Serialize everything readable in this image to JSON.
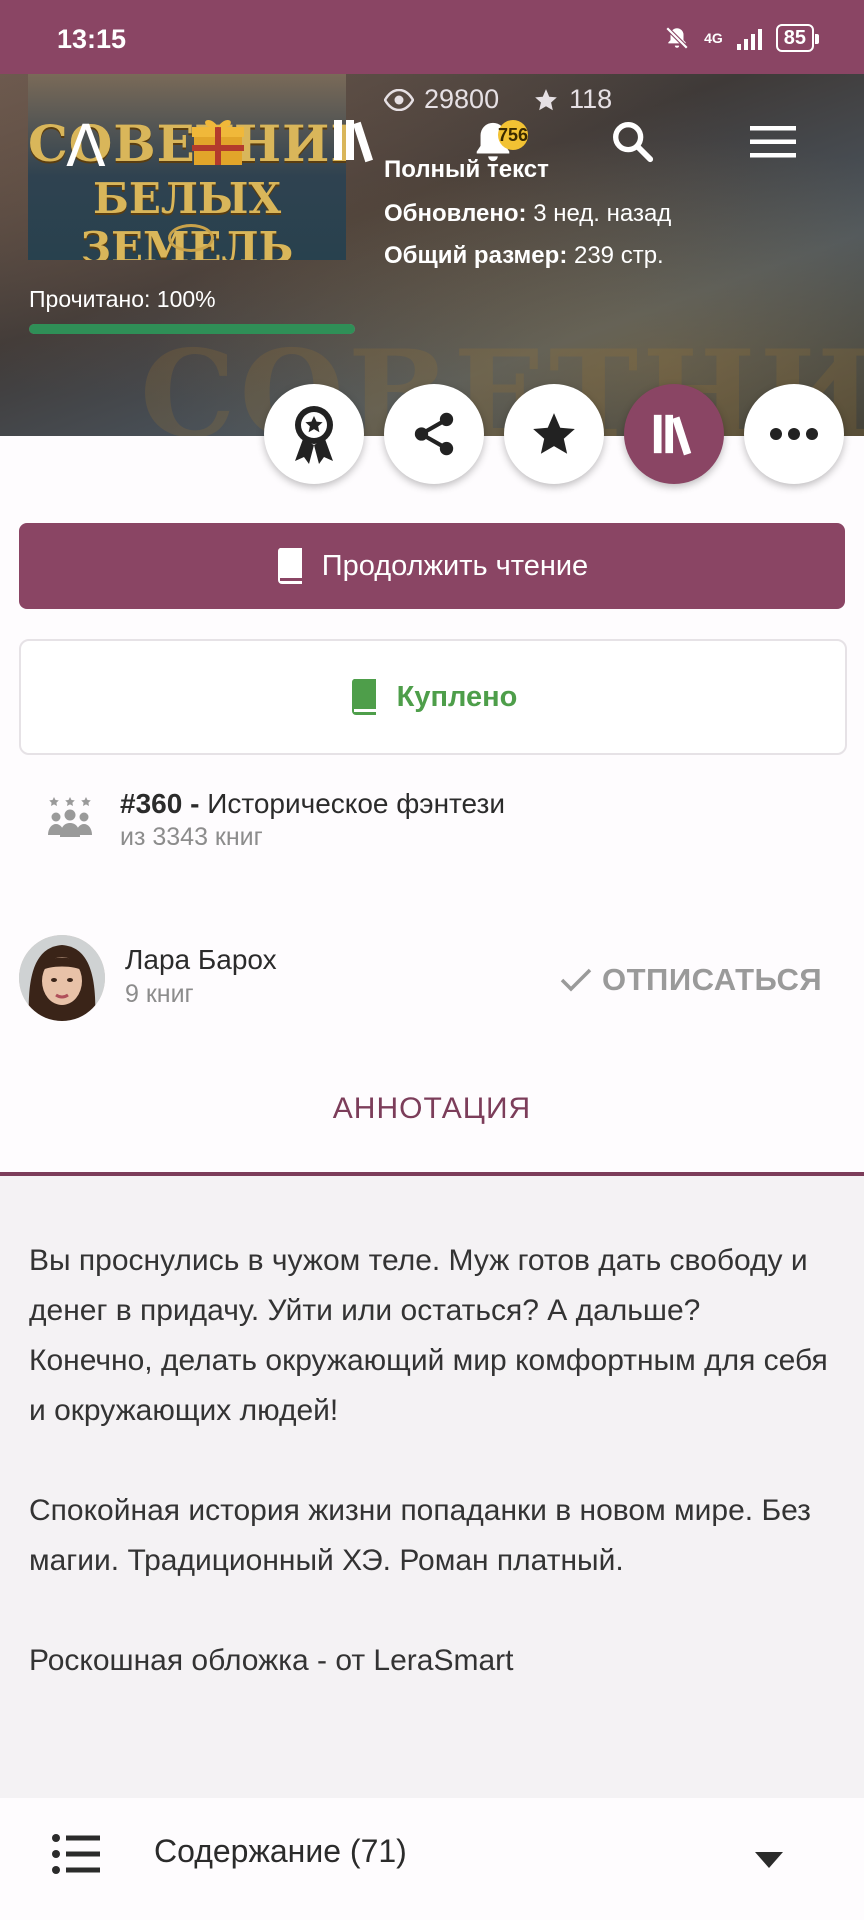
{
  "status_bar": {
    "time": "13:15",
    "network": "4G",
    "battery": "85"
  },
  "toolbar": {
    "logo": "Λ",
    "notifications_count": "756"
  },
  "book": {
    "cover_title_line1": "СОВЕТНИК",
    "cover_title_line2": "БЕЛЫХ ЗЕМЕЛЬ",
    "views": "29800",
    "stars": "118",
    "status": "Полный текст",
    "updated_label": "Обновлено:",
    "updated_value": "3 нед. назад",
    "size_label": "Общий размер:",
    "size_value": "239 стр.",
    "progress_label": "Прочитано: 100%",
    "progress_fraction": 1.0
  },
  "actions": {
    "continue_label": "Продолжить чтение",
    "bought_label": "Куплено"
  },
  "rank": {
    "position": "#360 -",
    "genre": "Историческое фэнтези",
    "total": "из 3343 книг"
  },
  "author": {
    "name": "Лара Барох",
    "books": "9 книг",
    "unsubscribe_label": "ОТПИСАТЬСЯ"
  },
  "tab": {
    "label": "АННОТАЦИЯ"
  },
  "annotation": {
    "p1": "Вы проснулись в чужом теле. Муж готов дать свободу и денег в придачу. Уйти или остаться? А дальше? Конечно, делать окружающий мир комфортным для себя и окружающих людей!",
    "p2": "Спокойная история жизни попаданки в новом мире. Без магии. Традиционный ХЭ. Роман платный.",
    "p3": "Роскошная обложка - от LeraSmart"
  },
  "contents": {
    "label": "Содержание (71)"
  },
  "colors": {
    "accent": "#8a4564",
    "bought": "#4e9e4a",
    "progress": "#2f8f57",
    "badge": "#f2c233"
  },
  "icons": [
    "mute-bell-icon",
    "signal-icon",
    "battery-icon",
    "logo-icon",
    "gift-icon",
    "library-icon",
    "bell-icon",
    "search-icon",
    "menu-icon",
    "eye-icon",
    "star-icon",
    "award-icon",
    "share-icon",
    "star-icon",
    "library-icon",
    "more-icon",
    "book-icon",
    "green-book-icon",
    "rank-icon",
    "check-icon",
    "list-icon",
    "chevron-down-icon"
  ]
}
